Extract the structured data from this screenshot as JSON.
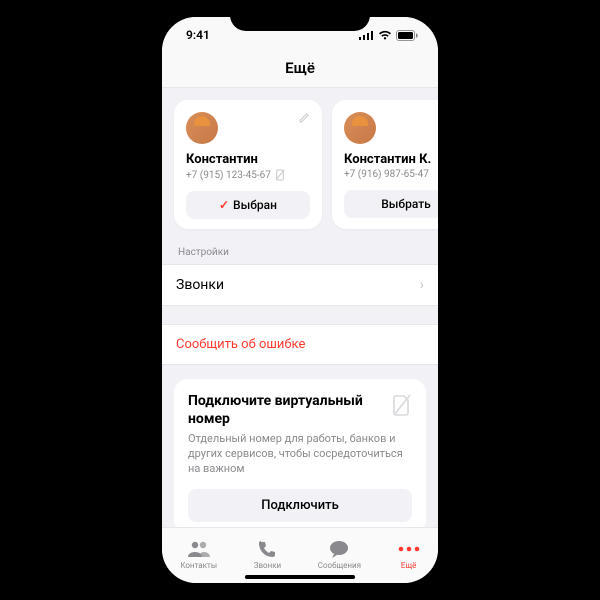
{
  "status": {
    "time": "9:41"
  },
  "header": {
    "title": "Ещё"
  },
  "cards": [
    {
      "name": "Константин",
      "phone": "+7 (915) 123-45-67",
      "button": "Выбран",
      "selected": true
    },
    {
      "name": "Константин К.",
      "phone": "+7 (916) 987-65-47",
      "button": "Выбрать",
      "selected": false
    }
  ],
  "section_settings": {
    "label": "Настройки",
    "row_calls": "Звонки"
  },
  "report_error": "Сообщить об ошибке",
  "promo": {
    "title": "Подключите виртуальный номер",
    "desc": "Отдельный номер для работы, банков и других сервисов, чтобы сосредоточиться на важном",
    "button": "Подключить"
  },
  "tabs": {
    "contacts": "Контакты",
    "calls": "Звонки",
    "messages": "Сообщения",
    "more": "Ещё"
  }
}
